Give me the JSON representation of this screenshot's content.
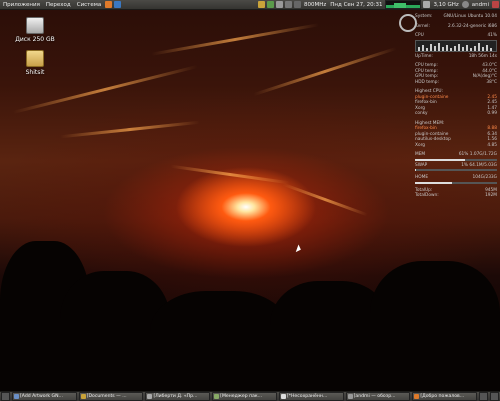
{
  "top_panel": {
    "menus": [
      "Приложения",
      "Переход",
      "Система"
    ],
    "cpu_freq": "800MHz",
    "datetime": "Пнд Сен 27, 20:31",
    "cpu_freq2": "3,10 GHz",
    "user": "andmi"
  },
  "desktop": {
    "icons": [
      {
        "label": "Диск 250 GB",
        "icon": "drive-icon"
      },
      {
        "label": "Shitsit",
        "icon": "folder-icon"
      }
    ]
  },
  "conky": {
    "system": {
      "label": "System:",
      "value": "GNU/Linux Ubuntu 10.04"
    },
    "kernel": {
      "label": "Kernel:",
      "value": "2.6.32-24-generic i686"
    },
    "cpu": {
      "label": "CPU",
      "value": "41%"
    },
    "uptime": {
      "label": "UpTime:",
      "value": "18h 56m 14s"
    },
    "cpu_temp": {
      "label": "CPU temp:",
      "value": "43.0°C"
    },
    "cpu_temp2": {
      "label": "CPU temp:",
      "value": "44.0°C"
    },
    "gpu_temp": {
      "label": "GPU temp:",
      "value": "N/A(deg)°C"
    },
    "hdd_temp": {
      "label": "HDD temp:",
      "value": "38°C"
    },
    "highest_cpu": {
      "title": "Highest CPU:",
      "rows": [
        {
          "name": "plugin-containe",
          "value": "2.45",
          "highlight": true
        },
        {
          "name": "firefox-bin",
          "value": "2.45",
          "highlight": false
        },
        {
          "name": "Xorg",
          "value": "1.47",
          "highlight": false
        },
        {
          "name": "conky",
          "value": "0.99",
          "highlight": false
        }
      ]
    },
    "highest_mem": {
      "title": "Highest MEM:",
      "rows": [
        {
          "name": "firefox-bin",
          "value": "8.88",
          "highlight": true
        },
        {
          "name": "plugin-containe",
          "value": "6.34",
          "highlight": false
        },
        {
          "name": "nautilus-desktop",
          "value": "1.56",
          "highlight": false
        },
        {
          "name": "Xorg",
          "value": "4.85",
          "highlight": false
        }
      ]
    },
    "mem": {
      "label": "MEM",
      "value": "61% 1.07G/1.72G",
      "fraction": 0.61
    },
    "swap": {
      "label": "SWAP",
      "value": "1% 64.1M/5.03G",
      "fraction": 0.01
    },
    "home": {
      "label": "HOME",
      "value": "104G/233G",
      "fraction": 0.45
    },
    "total_up": {
      "label": "TotalUp:",
      "value": "945M"
    },
    "total_down": {
      "label": "TotalDown:",
      "value": "192M"
    }
  },
  "taskbar": {
    "tasks": [
      "[Add Artwork GN...",
      "[Documents — ...",
      "[Либерти Д. «Пр...",
      "[Менеджер пак...",
      "[*Несохранённ...",
      "[andmi — обозр...",
      "[Добро пожалов..."
    ]
  },
  "colors": {
    "accent": "#ff8a4a",
    "panel": "#3f3e3a"
  }
}
